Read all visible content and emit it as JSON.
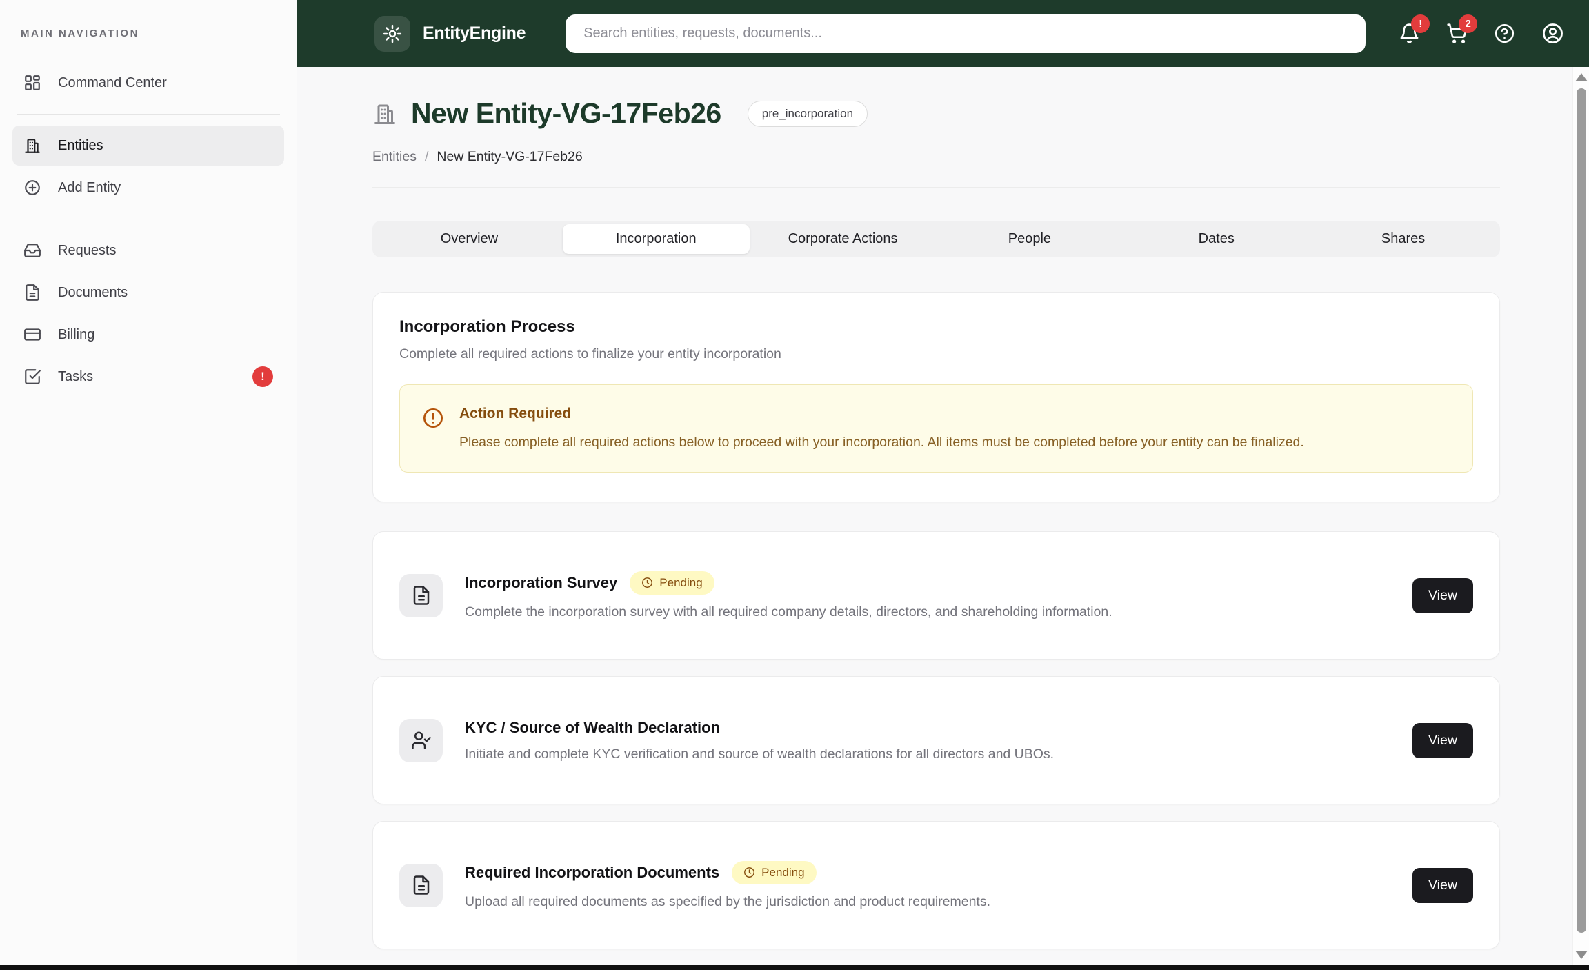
{
  "app": {
    "name": "EntityEngine"
  },
  "header": {
    "search": {
      "placeholder": "Search entities, requests, documents...",
      "value": ""
    },
    "notifications": {
      "badge": "!"
    },
    "cart": {
      "badge": "2"
    }
  },
  "sidebar": {
    "section_label": "MAIN NAVIGATION",
    "items": [
      {
        "label": "Command Center",
        "icon": "dashboard-grid"
      },
      {
        "label": "Entities",
        "icon": "building",
        "active": true
      },
      {
        "label": "Add Entity",
        "icon": "plus-circle"
      },
      {
        "label": "Requests",
        "icon": "inbox"
      },
      {
        "label": "Documents",
        "icon": "file-text"
      },
      {
        "label": "Billing",
        "icon": "credit-card"
      },
      {
        "label": "Tasks",
        "icon": "check-square",
        "badge": "!"
      }
    ]
  },
  "page": {
    "title": "New Entity-VG-17Feb26",
    "status_badge": "pre_incorporation",
    "breadcrumb": {
      "parent": "Entities",
      "separator": "/",
      "current": "New Entity-VG-17Feb26"
    }
  },
  "tabs": [
    {
      "label": "Overview",
      "active": false
    },
    {
      "label": "Incorporation",
      "active": true
    },
    {
      "label": "Corporate Actions",
      "active": false
    },
    {
      "label": "People",
      "active": false
    },
    {
      "label": "Dates",
      "active": false
    },
    {
      "label": "Shares",
      "active": false
    }
  ],
  "process_card": {
    "title": "Incorporation Process",
    "subtitle": "Complete all required actions to finalize your entity incorporation",
    "alert": {
      "title": "Action Required",
      "message": "Please complete all required actions below to proceed with your incorporation. All items must be completed before your entity can be finalized."
    }
  },
  "action_cards": [
    {
      "title": "Incorporation Survey",
      "status": "Pending",
      "description": "Complete the incorporation survey with all required company details, directors, and shareholding information.",
      "button": "View",
      "icon": "file-text"
    },
    {
      "title": "KYC / Source of Wealth Declaration",
      "status": null,
      "description": "Initiate and complete KYC verification and source of wealth declarations for all directors and UBOs.",
      "button": "View",
      "icon": "user-check"
    },
    {
      "title": "Required Incorporation Documents",
      "status": "Pending",
      "description": "Upload all required documents as specified by the jurisdiction and product requirements.",
      "button": "View",
      "icon": "file-text"
    }
  ],
  "colors": {
    "header_green": "#1e3b2b",
    "title_green": "#1d3a2a",
    "badge_red": "#e23c3c",
    "pending_bg": "#fef9c3",
    "pending_text": "#854d0e",
    "alert_bg": "#fefce8",
    "view_button_bg": "#1b1b1f"
  }
}
